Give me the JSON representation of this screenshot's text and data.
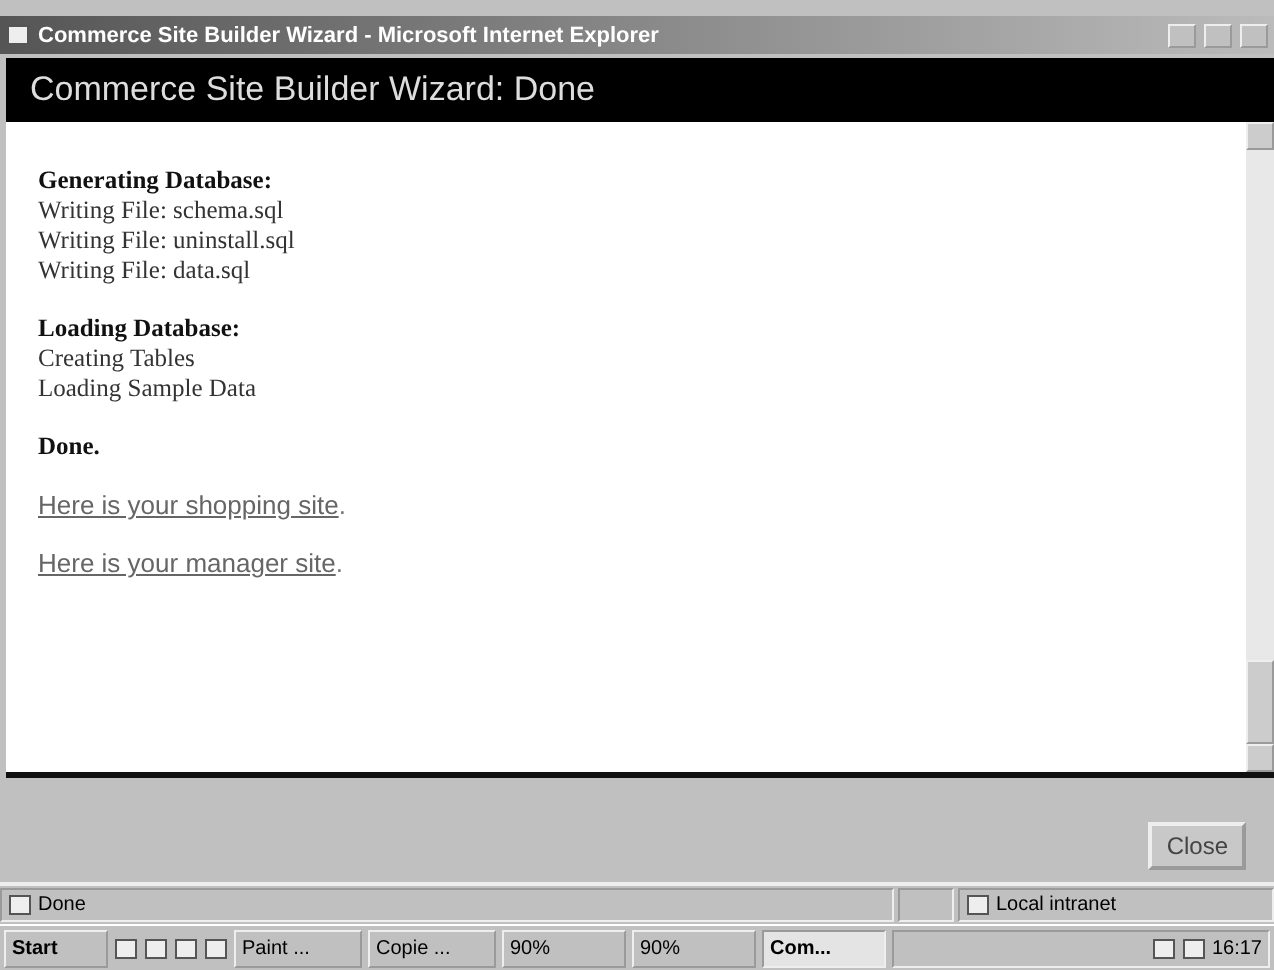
{
  "window": {
    "title": "Commerce Site Builder Wizard - Microsoft Internet Explorer"
  },
  "header": {
    "title": "Commerce Site Builder Wizard: Done"
  },
  "sections": [
    {
      "heading": "Generating Database:",
      "lines": [
        "Writing File: schema.sql",
        "Writing File: uninstall.sql",
        "Writing File: data.sql"
      ]
    },
    {
      "heading": "Loading Database:",
      "lines": [
        "Creating Tables",
        "Loading Sample Data"
      ]
    },
    {
      "heading": "Done."
    }
  ],
  "links": [
    {
      "text": "Here is your shopping site",
      "suffix": "."
    },
    {
      "text": "Here is your manager site",
      "suffix": "."
    }
  ],
  "footer": {
    "button": "Close"
  },
  "status_bar": {
    "status": "Done",
    "zone": "Local intranet"
  },
  "taskbar": {
    "start": "Start",
    "tasks": [
      {
        "label": "Paint ...",
        "selected": false
      },
      {
        "label": "Copie ...",
        "selected": false
      },
      {
        "label": "90%",
        "selected": false
      },
      {
        "label": "90%",
        "selected": false
      },
      {
        "label": "Com...",
        "selected": true
      }
    ],
    "clock": "16:17"
  }
}
